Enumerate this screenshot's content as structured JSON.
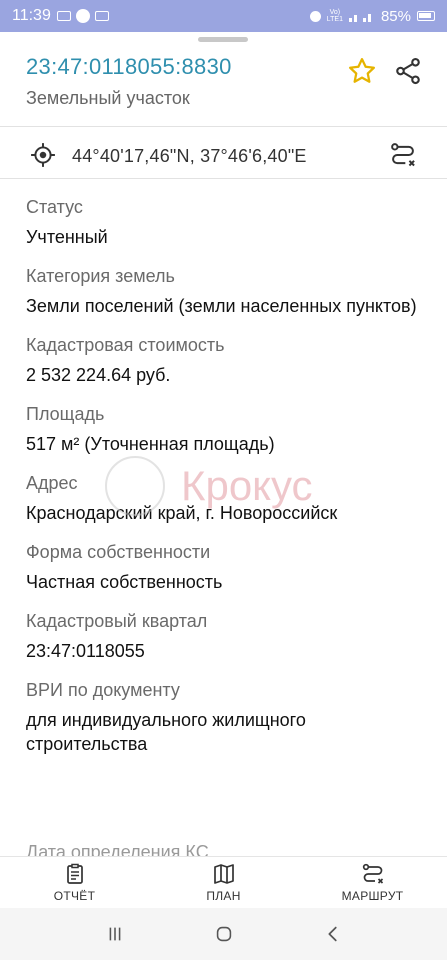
{
  "status_bar": {
    "time": "11:39",
    "battery": "85%",
    "icons": [
      "message-icon",
      "phone-icon",
      "gallery-icon",
      "alarm-icon",
      "volte-icon",
      "signal-icon",
      "battery-icon"
    ]
  },
  "header": {
    "cadastral_number": "23:47:0118055:8830",
    "subtitle": "Земельный участок"
  },
  "coordinates": {
    "text": "44°40'17,46\"N, 37°46'6,40\"E"
  },
  "fields": [
    {
      "label": "Статус",
      "value": "Учтенный"
    },
    {
      "label": "Категория земель",
      "value": "Земли поселений (земли населенных пунктов)"
    },
    {
      "label": "Кадастровая стоимость",
      "value": "2 532 224.64 руб."
    },
    {
      "label": "Площадь",
      "value": "517 м² (Уточненная площадь)"
    },
    {
      "label": "Адрес",
      "value": "Краснодарский край, г. Новороссийск"
    },
    {
      "label": "Форма собственности",
      "value": "Частная собственность"
    },
    {
      "label": "Кадастровый квартал",
      "value": "23:47:0118055"
    },
    {
      "label": "ВРИ по документу",
      "value": "для индивидуального жилищного строительства"
    }
  ],
  "next_field_label": "Дата определения КС",
  "watermark": "Крокус",
  "bottom_nav": {
    "report": "ОТЧЁТ",
    "plan": "ПЛАН",
    "route": "МАРШРУТ"
  },
  "colors": {
    "accent": "#2f8fae",
    "star": "#e6b400",
    "status_bar": "#9aa5e0"
  }
}
